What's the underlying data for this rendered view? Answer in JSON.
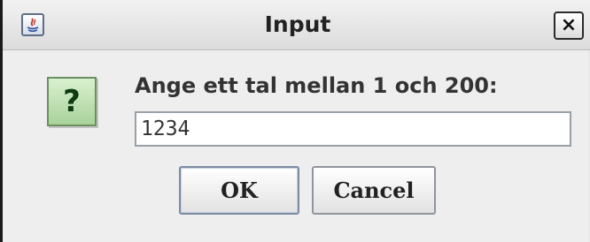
{
  "window": {
    "title": "Input",
    "close_symbol": "×"
  },
  "dialog": {
    "icon": "question-icon",
    "icon_symbol": "?",
    "prompt": "Ange ett tal mellan 1 och 200:",
    "input_value": "1234",
    "ok_label": "OK",
    "cancel_label": "Cancel"
  }
}
